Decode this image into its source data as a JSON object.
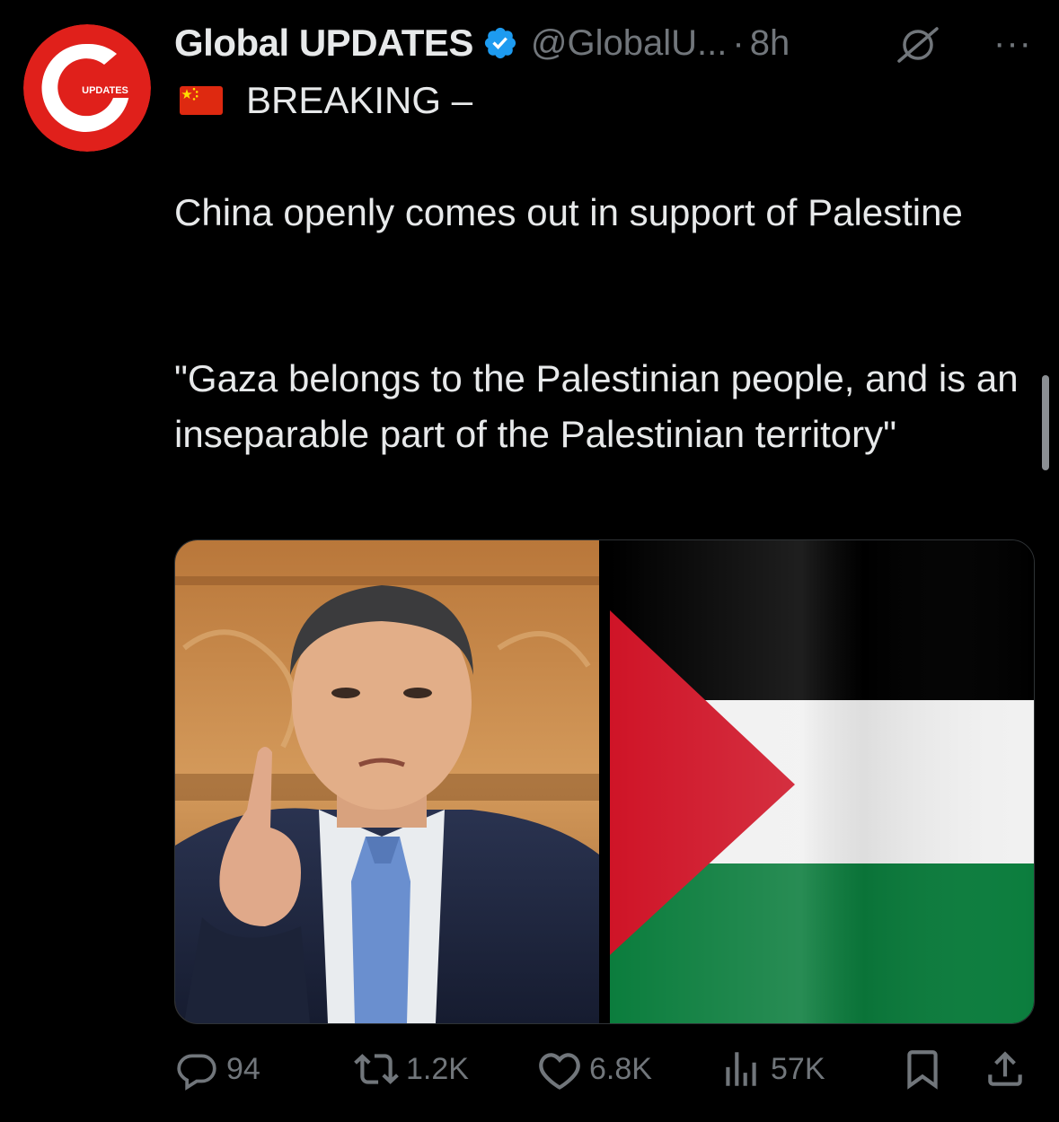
{
  "tweet": {
    "author": {
      "name": "Global UPDATES",
      "handle": "@GlobalU...",
      "avatar_letter": "G",
      "avatar_label": "UPDATES",
      "avatar_color": "#e0201b",
      "verified": true,
      "verified_color": "#1d9bf0"
    },
    "separator": "·",
    "time": "8h",
    "more_label": "···",
    "breaking_text": "BREAKING –",
    "body_1": "China openly comes out in support of Palestine",
    "body_2": "\"Gaza belongs to the Palestinian people, and is an inseparable part of the Palestinian territory\"",
    "media": {
      "left_image": "photo-portrait-speaker",
      "right_image": "palestine-flag"
    },
    "actions": {
      "replies": "94",
      "reposts": "1.2K",
      "likes": "6.8K",
      "views": "57K"
    }
  },
  "colors": {
    "background": "#000000",
    "text": "#e7e9ea",
    "muted": "#71767b",
    "accent": "#1d9bf0"
  }
}
